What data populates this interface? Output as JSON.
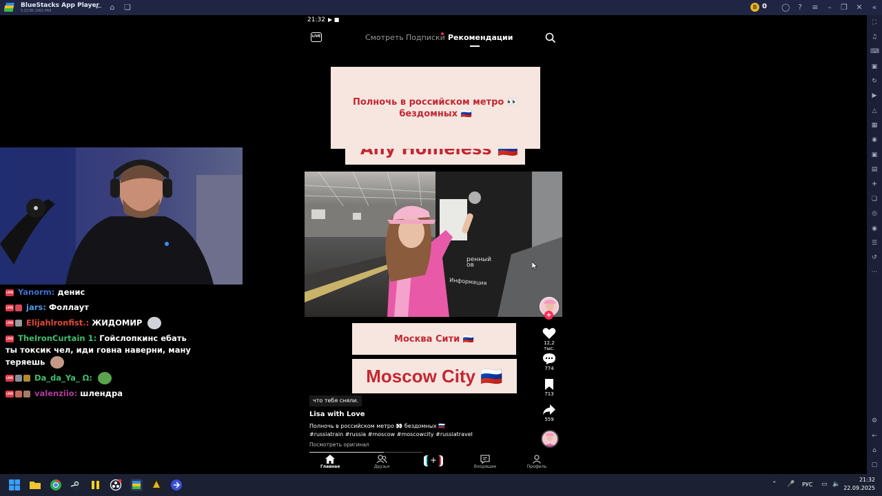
{
  "window": {
    "title": "BlueStacks App Player",
    "version": "5.22.85.1001 P64",
    "coins": "0"
  },
  "status_bar": {
    "time": "21:32"
  },
  "top_tabs": {
    "watch": "Смотреть",
    "subscriptions": "Подписки",
    "recommendations": "Рекомендации"
  },
  "icons": {
    "live": "LIVE",
    "search": "search-icon",
    "like": "heart-icon",
    "comment": "comment-icon",
    "save": "bookmark-icon",
    "share": "share-icon",
    "home": "home-icon",
    "friends": "friends-icon",
    "inbox": "inbox-icon",
    "profile": "profile-icon"
  },
  "video": {
    "card_top_text": "Полночь в российском метро 👀 бездомных 🇷🇺",
    "card_partial_text": "Any Homeless 🇷🇺",
    "card_moscow_ru": "Москва Сити 🇷🇺",
    "card_moscow_en": "Moscow City 🇷🇺",
    "sign_line1": "ренный",
    "sign_line2": "ов",
    "sign_line3": "Информация",
    "subtitle": "что тебя сняли.",
    "author": "Lisa with Love",
    "description": "Полночь в российском метро 👀 бездомных 🇷🇺",
    "hashtags": "#russiatrain #russia #moscow #moscowcity #russiatravel",
    "see_original": "Посмотреть оригинал",
    "progress": 0.66
  },
  "actions": {
    "likes": "12,2 тыс.",
    "comments": "774",
    "saves": "713",
    "shares": "559",
    "follow": "+"
  },
  "bottom_nav": {
    "home": "Главная",
    "friends": "Друзья",
    "create": "+",
    "inbox": "Входящие",
    "profile": "Профиль"
  },
  "chat": [
    {
      "user": "Yanorm:",
      "text": "денис"
    },
    {
      "user": "jars:",
      "text": "Фоллаут"
    },
    {
      "user": "Elijahlronfist.:",
      "text": "ЖИДОМИР"
    },
    {
      "user": "TheIronCurtain 1:",
      "text": "Гойслопкинс ебать ты токсик чел, иди говна наверни, ману теряешь"
    },
    {
      "user": "Da_da_Ya_ Ω:",
      "text": ""
    },
    {
      "user": "valenziio:",
      "text": "шлендра"
    }
  ],
  "taskbar": {
    "language": "РУС",
    "time": "21:32",
    "date": "22.09.2025"
  },
  "colors": {
    "titlebar": "#1f2542",
    "card_bg": "#f6e6df",
    "card_text": "#c42632",
    "accent_red": "#fe2c55",
    "accent_cyan": "#25f4ee"
  }
}
